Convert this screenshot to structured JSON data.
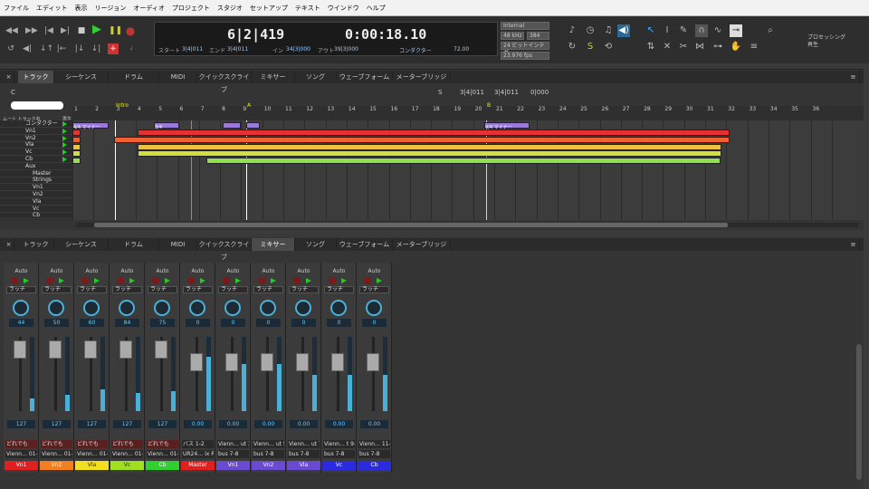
{
  "menu": [
    "ファイル",
    "エディット",
    "表示",
    "リージョン",
    "オーディオ",
    "プロジェクト",
    "スタジオ",
    "セットアップ",
    "テキスト",
    "ウインドウ",
    "ヘルプ"
  ],
  "counter": {
    "position": "6|2|419",
    "time": "0:00:18.10",
    "start_label": "スタート",
    "start": "3|4|011",
    "end_label": "エンド",
    "end": "3|4|011",
    "in_label": "イン",
    "in": "34|3|000",
    "out_label": "アウト",
    "out": "39|3|000",
    "conductor": "コンダクター",
    "tempo": "72.00"
  },
  "format": {
    "sync": "Internal",
    "rate": "48 kHz",
    "depth": "24 ビットインテガー",
    "bits": "384",
    "fps": "23.976 fps"
  },
  "right_status": {
    "line1": "プロセッシング",
    "line2": "再生"
  },
  "tabs": [
    "トラック",
    "シーケンス",
    "ドラム",
    "MIDI",
    "クイックスクライブ",
    "ミキサー",
    "ソング",
    "ウェーブフォーム",
    "メーターブリッジ"
  ],
  "edit_active_tab": 0,
  "mixer_active_tab": 5,
  "edit_toolbar": {
    "c": "C",
    "s": "S",
    "pos1": "3|4|011",
    "pos2": "3|4|011",
    "pos3": "0|000"
  },
  "track_header": {
    "mute": "ムート",
    "name": "トラック名",
    "play": "再生"
  },
  "tracks": [
    "コンダクター",
    "Vn1",
    "Vn2",
    "Vla",
    "Vc",
    "Cb",
    "Aux",
    "Master",
    "Strings",
    "Vn1",
    "Vn2",
    "Vla",
    "Vc",
    "Cb"
  ],
  "ruler": [
    "1",
    "2",
    "3",
    "4",
    "5",
    "6",
    "7",
    "8",
    "9",
    "10",
    "11",
    "12",
    "13",
    "14",
    "15",
    "16",
    "17",
    "18",
    "19",
    "20",
    "21",
    "22",
    "23",
    "24",
    "25",
    "26",
    "27",
    "28",
    "29",
    "30",
    "31",
    "32",
    "33",
    "34",
    "35",
    "36"
  ],
  "markers": {
    "intro": "Intro",
    "a": "A",
    "b": "B"
  },
  "conductor_clips": [
    "4/4 マイナー",
    "3/4",
    "4/4",
    "4/4 マイナー"
  ],
  "strips": [
    {
      "name": "Vn1",
      "pan": "44",
      "vol": "127",
      "in": "どれでも",
      "out": "Vienn… 01-0",
      "color": "#e02020"
    },
    {
      "name": "Vn2",
      "pan": "50",
      "vol": "127",
      "in": "どれでも",
      "out": "Vienn… 01-0",
      "color": "#f08020"
    },
    {
      "name": "Vla",
      "pan": "60",
      "vol": "127",
      "in": "どれでも",
      "out": "Vienn… 01-0",
      "color": "#f0e020"
    },
    {
      "name": "Vc",
      "pan": "84",
      "vol": "127",
      "in": "どれでも",
      "out": "Vienn… 01-0",
      "color": "#a0e020"
    },
    {
      "name": "Cb",
      "pan": "75",
      "vol": "127",
      "in": "どれでも",
      "out": "Vienn… 01-0",
      "color": "#30d030"
    },
    {
      "name": "Master",
      "pan": "0",
      "vol": "0.00",
      "in": "バス 1-2",
      "out": "UR24… ix R 1",
      "color": "#e02020"
    },
    {
      "name": "Vn1",
      "pan": "0",
      "vol": "0.00",
      "in": "Vienn… ut 3-4",
      "out": "bus 7-8",
      "color": "#6a4ad0"
    },
    {
      "name": "Vn2",
      "pan": "0",
      "vol": "0.00",
      "in": "Vienn… ut 5-6",
      "out": "bus 7-8",
      "color": "#6a4ad0"
    },
    {
      "name": "Vla",
      "pan": "0",
      "vol": "0.00",
      "in": "Vienn… ut 7-8",
      "out": "bus 7-8",
      "color": "#6a4ad0"
    },
    {
      "name": "Vc",
      "pan": "0",
      "vol": "0.00",
      "in": "Vienn… t 9-10",
      "out": "bus 7-8",
      "color": "#2a2ae0"
    },
    {
      "name": "Cb",
      "pan": "0",
      "vol": "0.00",
      "in": "Vienn… 11-12",
      "out": "bus 7-8",
      "color": "#2a2ae0"
    }
  ],
  "strip_auto": "Auto",
  "strip_latch": "ラッチ"
}
